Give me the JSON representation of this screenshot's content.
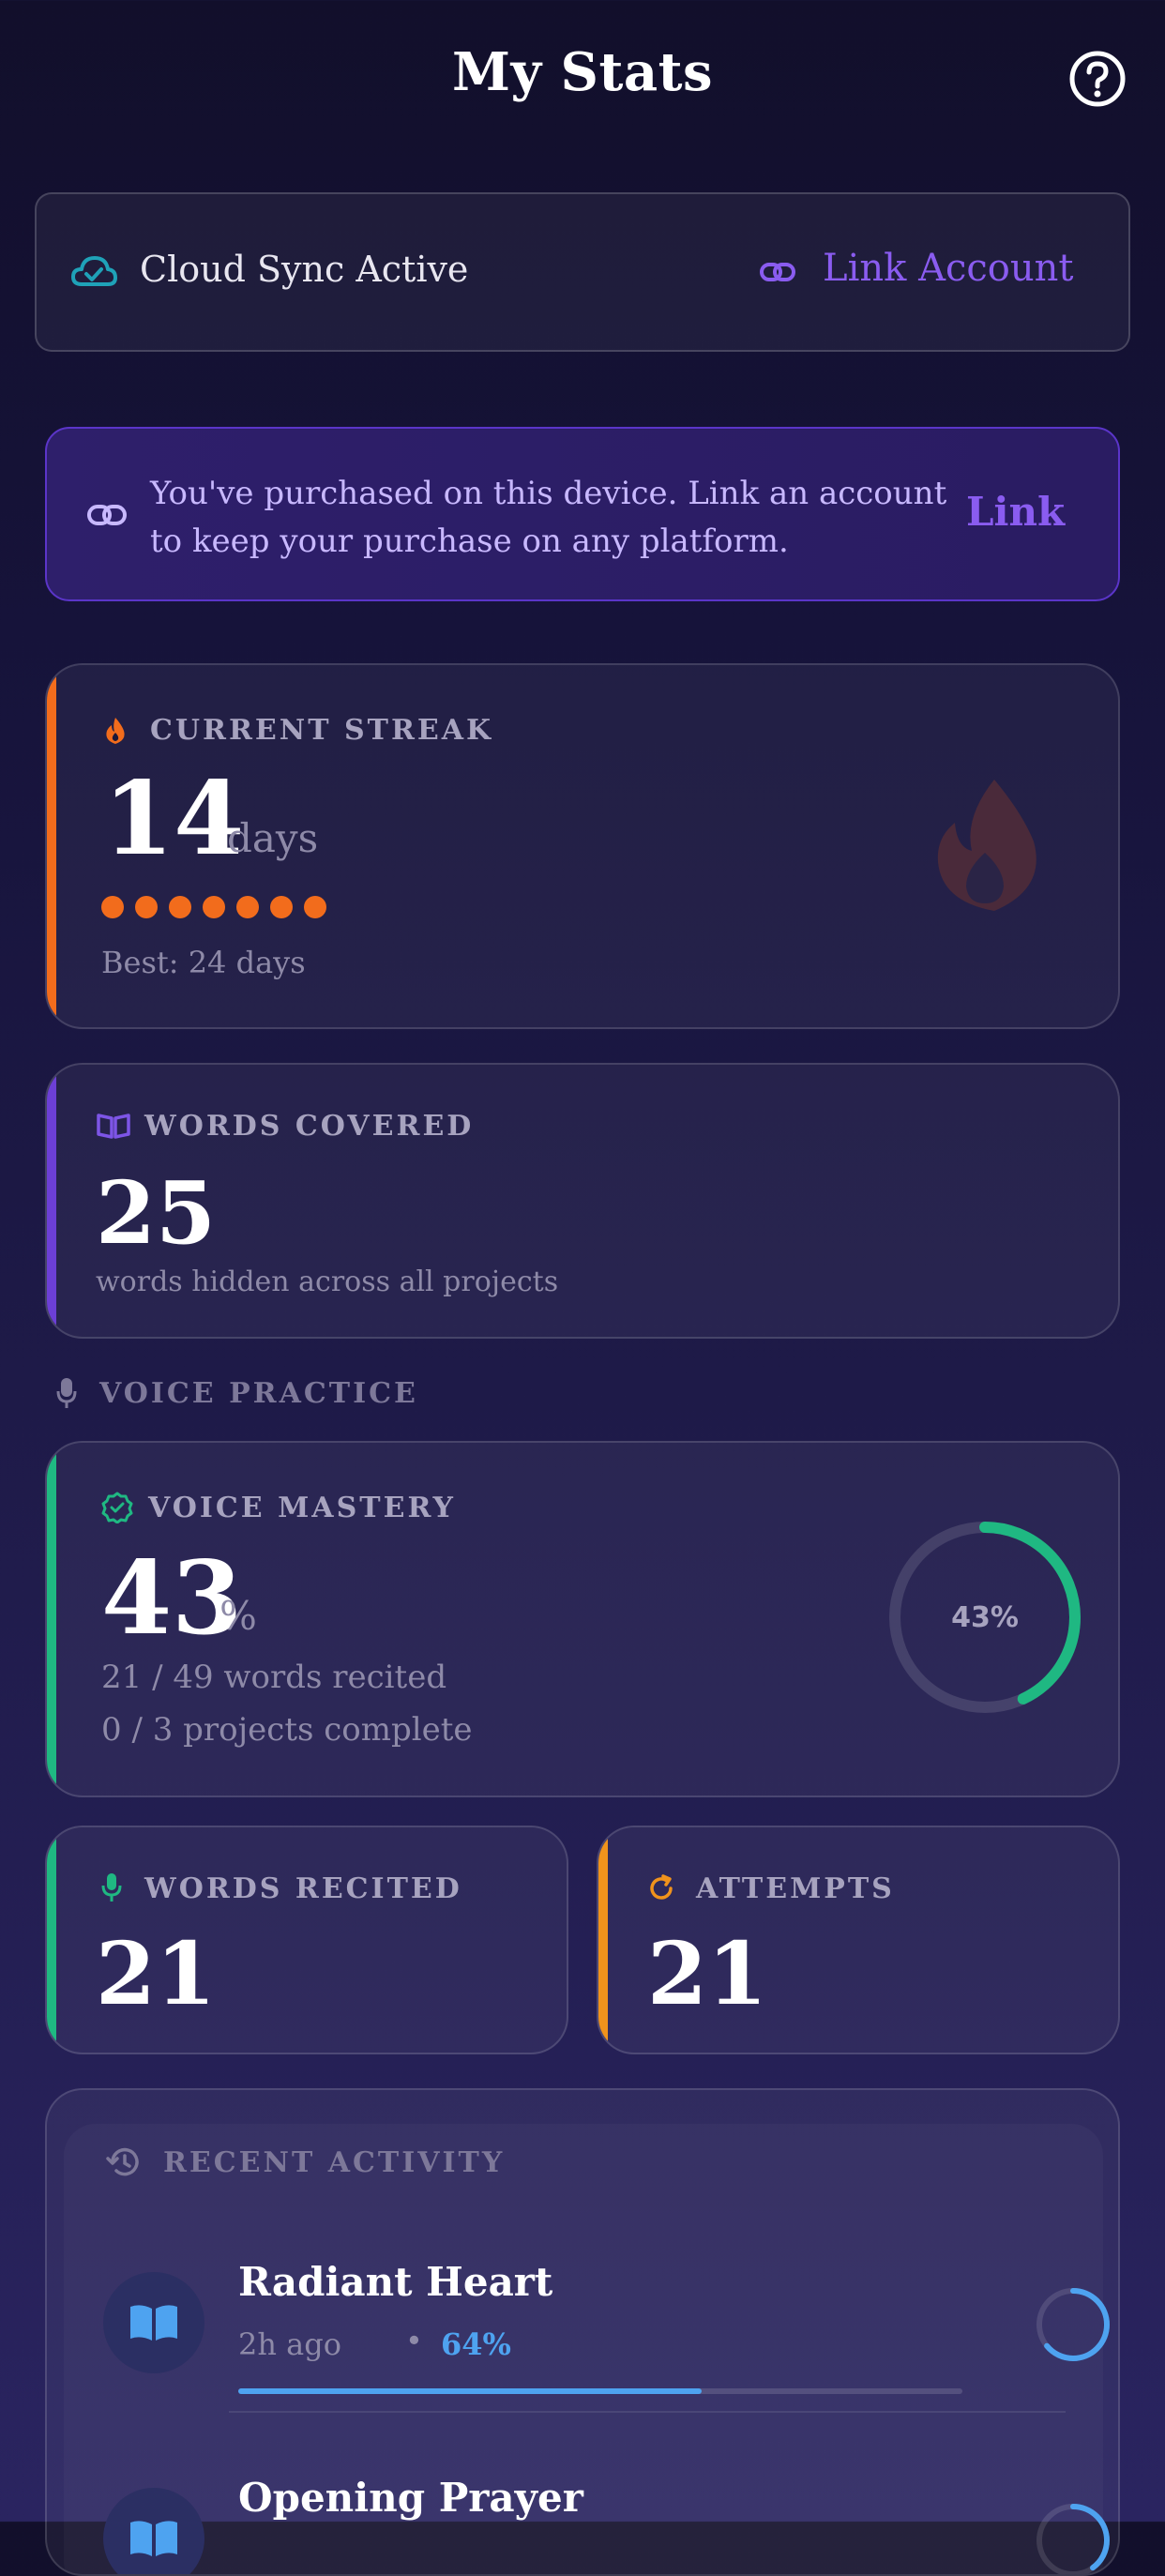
{
  "header": {
    "title": "My Stats",
    "help_icon": "help-circle-icon"
  },
  "sync": {
    "icon": "cloud-check-icon",
    "status_text": "Cloud Sync Active",
    "link_icon": "link-icon",
    "link_label": "Link Account"
  },
  "purchase_banner": {
    "icon": "link-icon",
    "line1": "You've purchased on this device. Link an account",
    "line2": "to keep your purchase on any platform.",
    "button_label": "Link"
  },
  "streak": {
    "label": "CURRENT STREAK",
    "value": "14",
    "unit": "days",
    "dots_filled": 7,
    "best": "Best: 24 days",
    "accent": "#f26c1c"
  },
  "words_covered": {
    "label": "WORDS COVERED",
    "value": "25",
    "subtitle": "words hidden across all projects",
    "accent": "#6c3fd6"
  },
  "voice_section": {
    "label": "VOICE PRACTICE"
  },
  "mastery": {
    "label": "VOICE MASTERY",
    "value": "43",
    "unit": "%",
    "recited": "21 / 49 words recited",
    "projects": "0 / 3 projects complete",
    "ring_percent": 43,
    "ring_label": "43%",
    "accent": "#1fb882"
  },
  "words_recited": {
    "label": "WORDS RECITED",
    "value": "21",
    "accent": "#1fb882"
  },
  "attempts": {
    "label": "ATTEMPTS",
    "value": "21",
    "accent": "#f0931c"
  },
  "recent_activity": {
    "label": "RECENT ACTIVITY",
    "items": [
      {
        "title": "Radiant Heart",
        "time": "2h ago",
        "separator": "•",
        "percent_label": "64%",
        "percent": 64,
        "ring_percent": 64
      },
      {
        "title": "Opening Prayer",
        "ring_percent": 40
      }
    ]
  }
}
